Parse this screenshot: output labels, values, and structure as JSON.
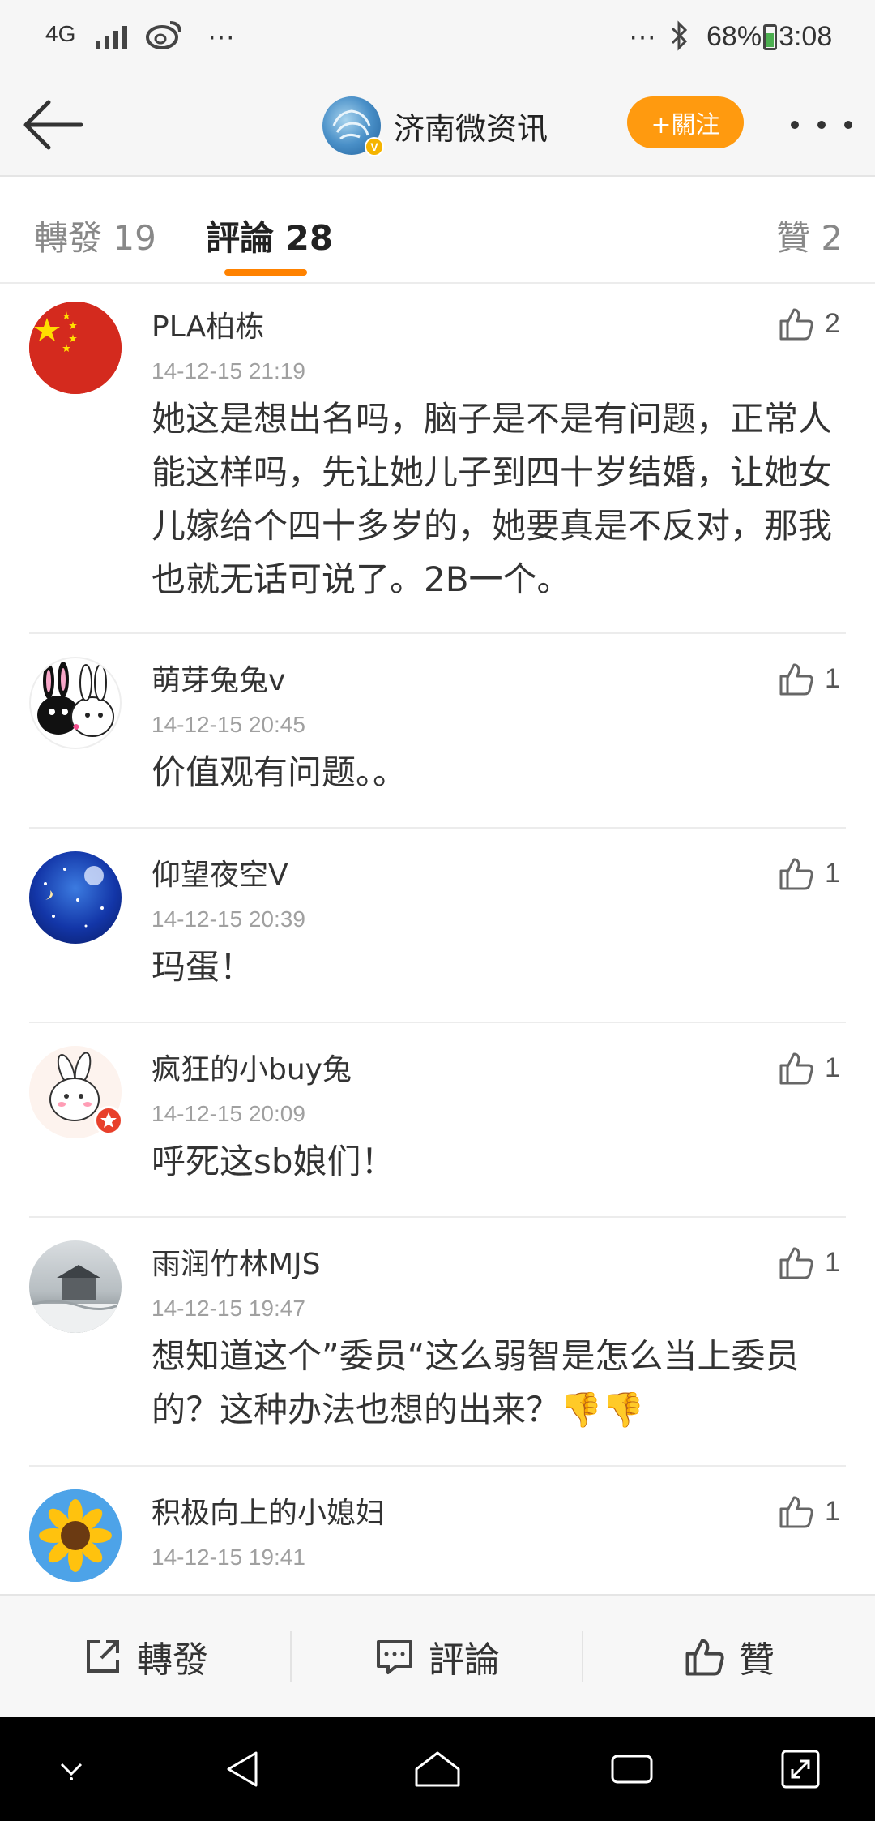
{
  "status_bar": {
    "network": "4G",
    "more_left": "···",
    "more_right": "···",
    "battery": "68%",
    "time": "3:08"
  },
  "header": {
    "account_name": "济南微资讯",
    "verified_mark": "V",
    "follow_label": "+關注"
  },
  "tabs": [
    {
      "label": "轉發 19"
    },
    {
      "label": "評論 28"
    },
    {
      "label": "贊 2"
    }
  ],
  "comments": [
    {
      "name": "PLA柏栋",
      "time": "14-12-15 21:19",
      "likes": "2",
      "text": "她这是想出名吗，脑子是不是有问题，正常人能这样吗，先让她儿子到四十岁结婚，让她女儿嫁给个四十多岁的，她要真是不反对，那我也就无话可说了。2B一个。"
    },
    {
      "name": "萌芽兔兔v",
      "time": "14-12-15 20:45",
      "likes": "1",
      "text": "价值观有问题。。"
    },
    {
      "name": "仰望夜空V",
      "time": "14-12-15 20:39",
      "likes": "1",
      "text": "玛蛋！"
    },
    {
      "name": "疯狂的小buy兔",
      "time": "14-12-15 20:09",
      "likes": "1",
      "text": "呼死这sb娘们！"
    },
    {
      "name": "雨润竹林MJS",
      "time": "14-12-15 19:47",
      "likes": "1",
      "text": "想知道这个”委员“这么弱智是怎么当上委员的？这种办法也想的出来？👎👎"
    },
    {
      "name": "积极向上的小媳妇",
      "time": "14-12-15 19:41",
      "likes": "1",
      "text": ""
    }
  ],
  "action_bar": {
    "repost_label": "轉發",
    "comment_label": "評論",
    "like_label": "贊"
  },
  "colors": {
    "accent": "#ff8200",
    "follow_button": "#ff9a0f",
    "header_bg": "#f6f6f6"
  }
}
